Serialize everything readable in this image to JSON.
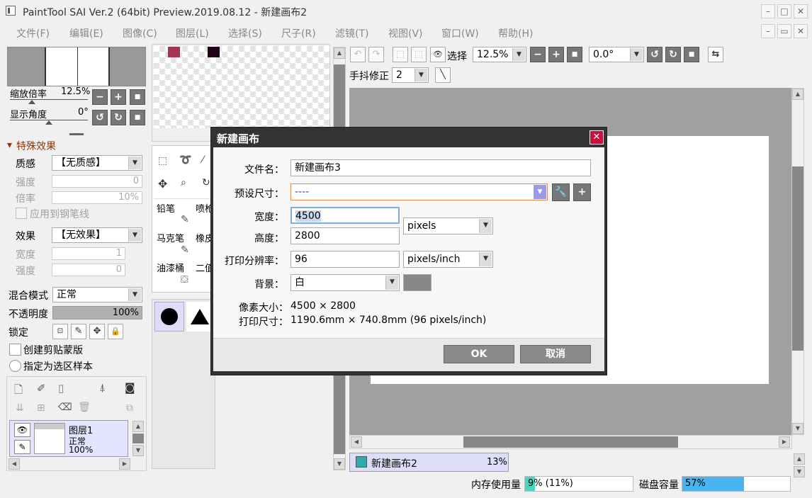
{
  "window": {
    "title": "PaintTool SAI Ver.2 (64bit) Preview.2019.08.12 - 新建画布2",
    "min": "–",
    "max": "□",
    "close": "✕",
    "restore_min": "–",
    "restore": "▭",
    "restore_close": "✕"
  },
  "menu": [
    "文件(F)",
    "编辑(E)",
    "图像(C)",
    "图层(L)",
    "选择(S)",
    "尺子(R)",
    "滤镜(T)",
    "视图(V)",
    "窗口(W)",
    "帮助(H)"
  ],
  "navigator": {
    "zoom_label": "缩放倍率",
    "zoom_value": "12.5%",
    "angle_label": "显示角度",
    "angle_value": "0°"
  },
  "effects": {
    "header": "特殊效果",
    "texture_label": "质感",
    "texture_value": "【无质感】",
    "strength_label": "强度",
    "strength_value": "0",
    "scale_label": "倍率",
    "scale_value": "10%",
    "apply_pen": "应用到钢笔线",
    "effect_label": "效果",
    "effect_value": "【无效果】",
    "width_label": "宽度",
    "width_value": "1",
    "strength2_label": "强度",
    "strength2_value": "0"
  },
  "layer_props": {
    "blend_label": "混合模式",
    "blend_value": "正常",
    "opacity_label": "不透明度",
    "opacity_value": "100%",
    "lock_label": "锁定",
    "clip_label": "创建剪贴蒙版",
    "selection_source_label": "指定为选区样本"
  },
  "layer": {
    "name": "图层1",
    "mode": "正常",
    "opacity": "100%"
  },
  "tools": [
    "铅笔",
    "喷枪",
    "马克笔",
    "橡皮",
    "油漆桶",
    "二值"
  ],
  "toolbar": {
    "select_label": "选择",
    "zoom": "12.5%",
    "angle": "0.0°",
    "stabilizer_label": "手抖修正",
    "stabilizer_value": "2"
  },
  "canvas_tab": {
    "name": "新建画布2",
    "zoom": "13%"
  },
  "status": {
    "mem_label": "内存使用量",
    "mem_value": "9% (11%)",
    "mem_fraction": 0.09,
    "disk_label": "磁盘容量",
    "disk_value": "57%",
    "disk_fraction": 0.57
  },
  "dialog": {
    "title": "新建画布",
    "close": "✕",
    "filename_label": "文件名：",
    "filename_value": "新建画布3",
    "preset_label": "预设尺寸：",
    "preset_value": "----",
    "width_label": "宽度：",
    "width_value": "4500",
    "height_label": "高度：",
    "height_value": "2800",
    "size_unit": "pixels",
    "dpi_label": "打印分辨率：",
    "dpi_value": "96",
    "dpi_unit": "pixels/inch",
    "bg_label": "背景：",
    "bg_value": "白",
    "pixel_size_label": "像素大小：",
    "pixel_size_value": "4500 × 2800",
    "print_size_label": "打印尺寸：",
    "print_size_value": "1190.6mm × 740.8mm (96 pixels/inch)",
    "ok": "OK",
    "cancel": "取消"
  },
  "colors": {
    "swatch1": "#a83254",
    "swatch2": "#1e0018",
    "accent_close": "#c8103a",
    "layer_sel": "#e4e4ff"
  }
}
